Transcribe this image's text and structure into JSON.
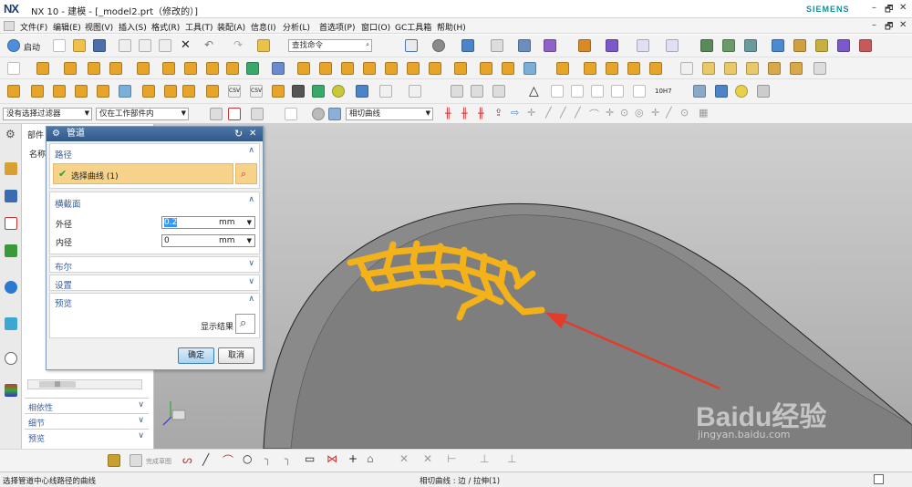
{
  "window": {
    "logo": "NX",
    "title": "NX 10 - 建模 - [_model2.prt（修改的）]",
    "brand": "SIEMENS",
    "min": "–",
    "restore": "🗗",
    "close": "✕"
  },
  "menu": [
    "文件(F)",
    "编辑(E)",
    "视图(V)",
    "插入(S)",
    "格式(R)",
    "工具(T)",
    "装配(A)",
    "信息(I)",
    "分析(L)",
    "首选项(P)",
    "窗口(O)",
    "GC工具箱",
    "帮助(H)"
  ],
  "toolbar": {
    "start_label": "启动",
    "find_placeholder": "查找命令",
    "filter_value": "没有选择过滤器",
    "scope_value": "仅在工作部件内",
    "curve_rule": "相切曲线",
    "chain_label_1": "10H7",
    "csv_1": "CSV",
    "csv_2": "CSV"
  },
  "nav": {
    "tab_label": "部件",
    "col_name": "名称",
    "sections": [
      "相依性",
      "细节",
      "预览"
    ],
    "scroll_mark": "|||"
  },
  "dialog": {
    "title": "管道",
    "path": {
      "header": "路径",
      "select_curve": "选择曲线 (1)"
    },
    "cross": {
      "header": "横截面",
      "outer_label": "外径",
      "outer_value": "0.2",
      "inner_label": "内径",
      "inner_value": "0",
      "unit": "mm"
    },
    "boolean_header": "布尔",
    "settings_header": "设置",
    "preview": {
      "header": "预览",
      "show_result": "显示结果"
    },
    "ok": "确定",
    "cancel": "取消"
  },
  "sketch": {
    "finish_label": "完成草图"
  },
  "status": {
    "left": "选择管道中心线路径的曲线",
    "center": "相切曲线 : 边 / 拉伸(1)"
  },
  "watermark": {
    "brand": "Baidu经验",
    "url": "jingyan.baidu.com"
  },
  "colors": {
    "accent": "#31598a",
    "pipe": "#f3b21a",
    "arrow": "#e43c2a",
    "check": "#2aa02a"
  }
}
